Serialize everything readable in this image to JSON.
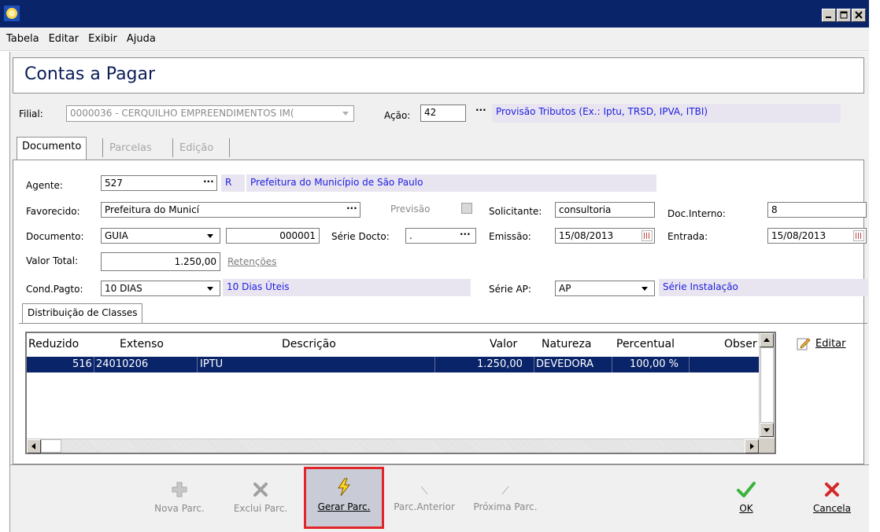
{
  "window": {
    "title": ""
  },
  "menu": [
    "Tabela",
    "Editar",
    "Exibir",
    "Ajuda"
  ],
  "header": {
    "title": "Contas a Pagar"
  },
  "filial": {
    "label": "Filial:",
    "value": "0000036 - CERQUILHO EMPREENDIMENTOS IM("
  },
  "acao": {
    "label": "Ação:",
    "value": "42",
    "description": "Provisão Tributos (Ex.: Iptu, TRSD, IPVA, ITBI)"
  },
  "tabs": [
    {
      "label": "Documento",
      "active": true
    },
    {
      "label": "Parcelas",
      "active": false
    },
    {
      "label": "Edição",
      "active": false
    }
  ],
  "form": {
    "agente": {
      "label": "Agente:",
      "value": "527",
      "type": "R",
      "description": "Prefeitura do Município de São Paulo"
    },
    "favorecido": {
      "label": "Favorecido:",
      "value": "Prefeitura do Municí"
    },
    "previsao": {
      "label": "Previsão",
      "checked": false
    },
    "solicitante": {
      "label": "Solicitante:",
      "value": "consultoria"
    },
    "doc_interno": {
      "label": "Doc.Interno:",
      "value": "8"
    },
    "documento": {
      "label": "Documento:",
      "type": "GUIA",
      "number": "000001"
    },
    "serie_docto": {
      "label": "Série Docto:",
      "value": "."
    },
    "emissao": {
      "label": "Emissão:",
      "value": "15/08/2013"
    },
    "entrada": {
      "label": "Entrada:",
      "value": "15/08/2013"
    },
    "valor_total": {
      "label": "Valor Total:",
      "value": "1.250,00"
    },
    "retencoes": {
      "label": "Retenções"
    },
    "cond_pagto": {
      "label": "Cond.Pagto:",
      "value": "10 DIAS",
      "description": "10 Dias Úteis"
    },
    "serie_ap": {
      "label": "Série AP:",
      "value": "AP",
      "description": "Série Instalação"
    }
  },
  "classes": {
    "tab_label": "Distribuição de Classes",
    "columns": [
      "Reduzido",
      "Extenso",
      "Descrição",
      "Valor",
      "Natureza",
      "Percentual",
      "Obser"
    ],
    "rows": [
      {
        "reduzido": "516",
        "extenso": "24010206",
        "descricao": "IPTU",
        "valor": "1.250,00",
        "natureza": "DEVEDORA",
        "percentual": "100,00 %"
      }
    ],
    "edit_label": "Editar"
  },
  "toolbar": {
    "nova": "Nova Parc.",
    "exclui": "Exclui Parc.",
    "gerar": "Gerar Parc.",
    "anterior": "Parc.Anterior",
    "proxima": "Próxima Parc.",
    "ok": "OK",
    "cancela": "Cancela"
  },
  "colors": {
    "titlebar": "#0a246a",
    "selection": "#0a246a",
    "description_bg": "#e9e5f0",
    "description_text": "#1c1ce0",
    "highlight_border": "#e0262a",
    "ok": "#3ab33a",
    "cancel": "#d62828"
  }
}
